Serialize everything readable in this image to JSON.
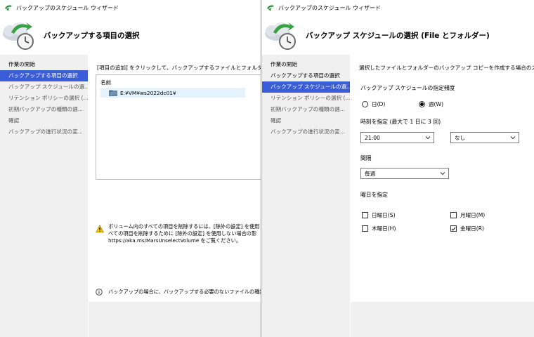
{
  "left_window": {
    "title": "バックアップのスケジュール ウィザード",
    "header_title": "バックアップする項目の選択",
    "steps": [
      {
        "label": "作業の開始",
        "state": "done"
      },
      {
        "label": "バックアップする項目の選択",
        "state": "active"
      },
      {
        "label": "バックアップ スケジュールの選...",
        "state": "pending"
      },
      {
        "label": "リテンション ポリシーの選択 (...",
        "state": "pending"
      },
      {
        "label": "初期バックアップの種類の選...",
        "state": "pending"
      },
      {
        "label": "確認",
        "state": "pending"
      },
      {
        "label": "バックアップの進行状況の変...",
        "state": "pending"
      }
    ],
    "instruction": "[項目の追加] をクリックして、バックアップするファイルとフォルダーを選択",
    "list_header": "名前",
    "list_items": [
      "E:¥VM¥ws2022dc01¥"
    ],
    "warning_lines": [
      "ボリューム内のすべての項目を削除するには、[除外の設定] を使用",
      "べての項目を削除するために [除外の設定] を使用しない場合の影",
      "https://aka.ms/MarsUnselectVolume をご覧ください。"
    ],
    "info_text": "バックアップの場合に、バックアップする必要のないファイルの種類"
  },
  "right_window": {
    "title": "バックアップのスケジュール ウィザード",
    "header_title": "バックアップ スケジュールの選択 (File とフォルダー)",
    "steps": [
      {
        "label": "作業の開始",
        "state": "done"
      },
      {
        "label": "バックアップする項目の選択",
        "state": "done"
      },
      {
        "label": "バックアップ スケジュールの選...",
        "state": "active"
      },
      {
        "label": "リテンション ポリシーの選択 (...",
        "state": "pending"
      },
      {
        "label": "初期バックアップの種類の選...",
        "state": "pending"
      },
      {
        "label": "確認",
        "state": "pending"
      },
      {
        "label": "バックアップの進行状況の変...",
        "state": "pending"
      }
    ],
    "instruction": "選択したファイルとフォルダーのバックアップ コピーを作成する場合のスケジュー",
    "frequency_label": "バックアップ スケジュールの指定頻度",
    "radio_daily": "日(D)",
    "radio_weekly": "週(W)",
    "selected_frequency": "weekly",
    "time_label": "時刻を指定 (最大で 1 日に 3 回)",
    "time_value": "21:00",
    "time2_value": "なし",
    "interval_label": "間隔",
    "interval_value": "毎週",
    "weekday_label": "曜日を指定",
    "days": {
      "sun": {
        "label": "日曜日(S)",
        "checked": false
      },
      "mon": {
        "label": "月曜日(M)",
        "checked": false
      },
      "thu": {
        "label": "木曜日(H)",
        "checked": false
      },
      "fri": {
        "label": "金曜日(R)",
        "checked": true
      }
    }
  },
  "colors": {
    "active_step_bg": "#3b5ed8",
    "steps_bg": "#f0f0f0",
    "selection_bg": "#e5f3ff"
  }
}
